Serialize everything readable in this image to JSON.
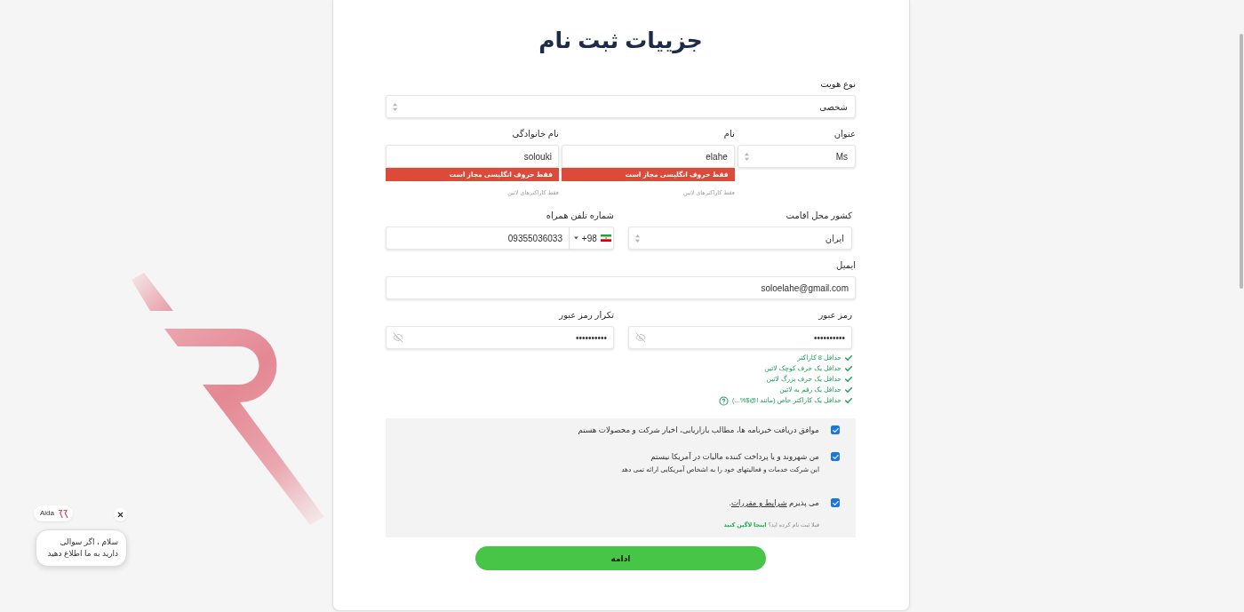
{
  "title": "جزییات ثبت نام",
  "identity_type": {
    "label": "نوع هویت",
    "value": "شخصی"
  },
  "name_fields": [
    {
      "kind": "select",
      "label": "عنوان",
      "value": "Ms"
    },
    {
      "kind": "input",
      "label": "نام",
      "value": "elahe",
      "error": "فقط حروف انگلیسی مجاز است",
      "hint": "فقط کاراکترهای لاتین"
    },
    {
      "kind": "input",
      "label": "نام خانوادگی",
      "value": "solouki",
      "error": "فقط حروف انگلیسی مجاز است",
      "hint": "فقط کاراکترهای لاتین"
    }
  ],
  "country": {
    "label": "کشور محل اقامت",
    "value": "ایران"
  },
  "phone": {
    "label": "شماره تلفن همراه",
    "code": "+98",
    "value": "09355036033"
  },
  "email": {
    "label": "ایمیل",
    "value": "soloelahe@gmail.com"
  },
  "passwords": [
    {
      "label": "رمز عبور",
      "value": "••••••••••"
    },
    {
      "label": "تکرار رمز عبور",
      "value": "••••••••••"
    }
  ],
  "password_rules": [
    {
      "text": "حداقل 8 کاراکتر",
      "met": true,
      "help": false
    },
    {
      "text": "حداقل یک حرف کوچک لاتین",
      "met": true,
      "help": false
    },
    {
      "text": "حداقل یک حرف بزرگ لاتین",
      "met": true,
      "help": false
    },
    {
      "text": "حداقل یک رقم به لاتین",
      "met": true,
      "help": false
    },
    {
      "text": "حداقل یک کاراکتر خاص (مانند !@$%...)",
      "met": true,
      "help": true
    }
  ],
  "consents": [
    {
      "text": "موافق دریافت خبرنامه ها، مطالب بازاریابی، اخبار شرکت و محصولات هستم",
      "checked": true
    },
    {
      "text": "من شهروند و یا پرداخت کننده مالیات در آمریکا نیستم",
      "note": "این شرکت خدمات و فعالیتهای خود را به اشخاص آمریکایی ارائه نمی دهد",
      "checked": true
    },
    {
      "text": "می پذیرم",
      "link": "شرایط و مقررات",
      "suffix": ".",
      "checked": true
    }
  ],
  "login_prompt": {
    "text": "قبلا ثبت نام کرده اید؟",
    "link": "اینجا لاگین کنید"
  },
  "submit": {
    "label": "ادامه"
  },
  "chat": {
    "name": "Aida",
    "message": "سلام ، اگر سوالی\nدارید به ما اطلاع دهید"
  }
}
